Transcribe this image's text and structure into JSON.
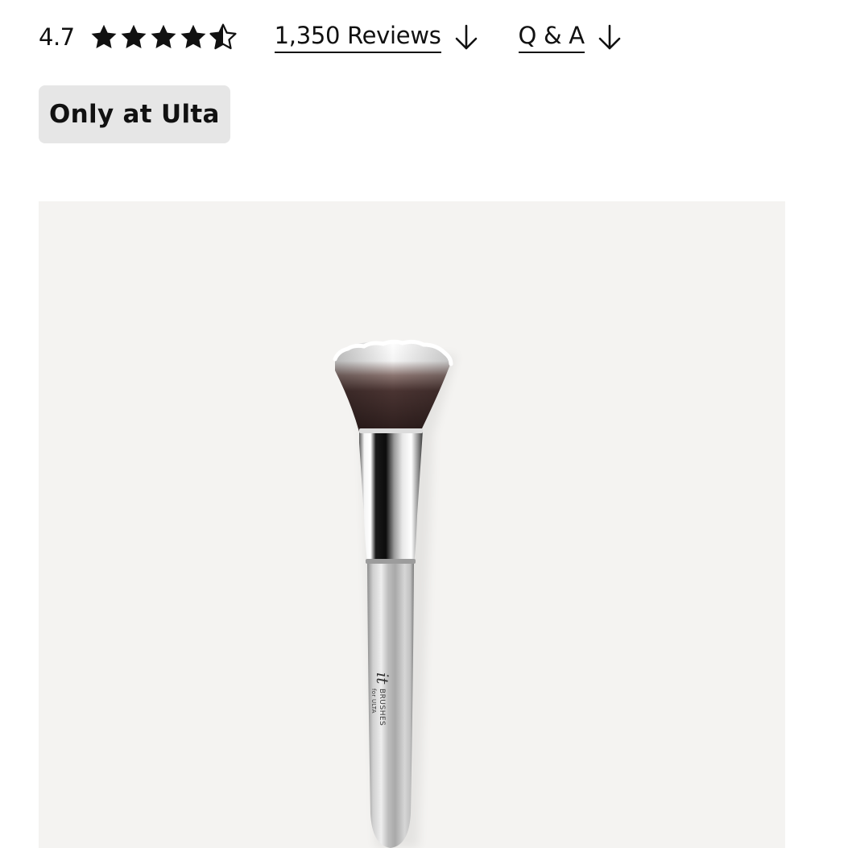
{
  "rating": {
    "value": "4.7",
    "stars": [
      1,
      1,
      1,
      1,
      0.5
    ],
    "star_color": "#111111",
    "star_icon": "star-icon"
  },
  "reviews_link": {
    "label": "1,350 Reviews",
    "icon": "arrow-down-icon"
  },
  "qa_link": {
    "label": "Q & A",
    "icon": "arrow-down-icon"
  },
  "badge": {
    "label": "Only at Ulta",
    "background": "#e6e6e6"
  },
  "product_image": {
    "subject": "makeup-brush",
    "background": "#f4f3f1",
    "brand_logo": "it",
    "brand_text": "BRUSHES",
    "brand_subtext": "for ULTA"
  }
}
